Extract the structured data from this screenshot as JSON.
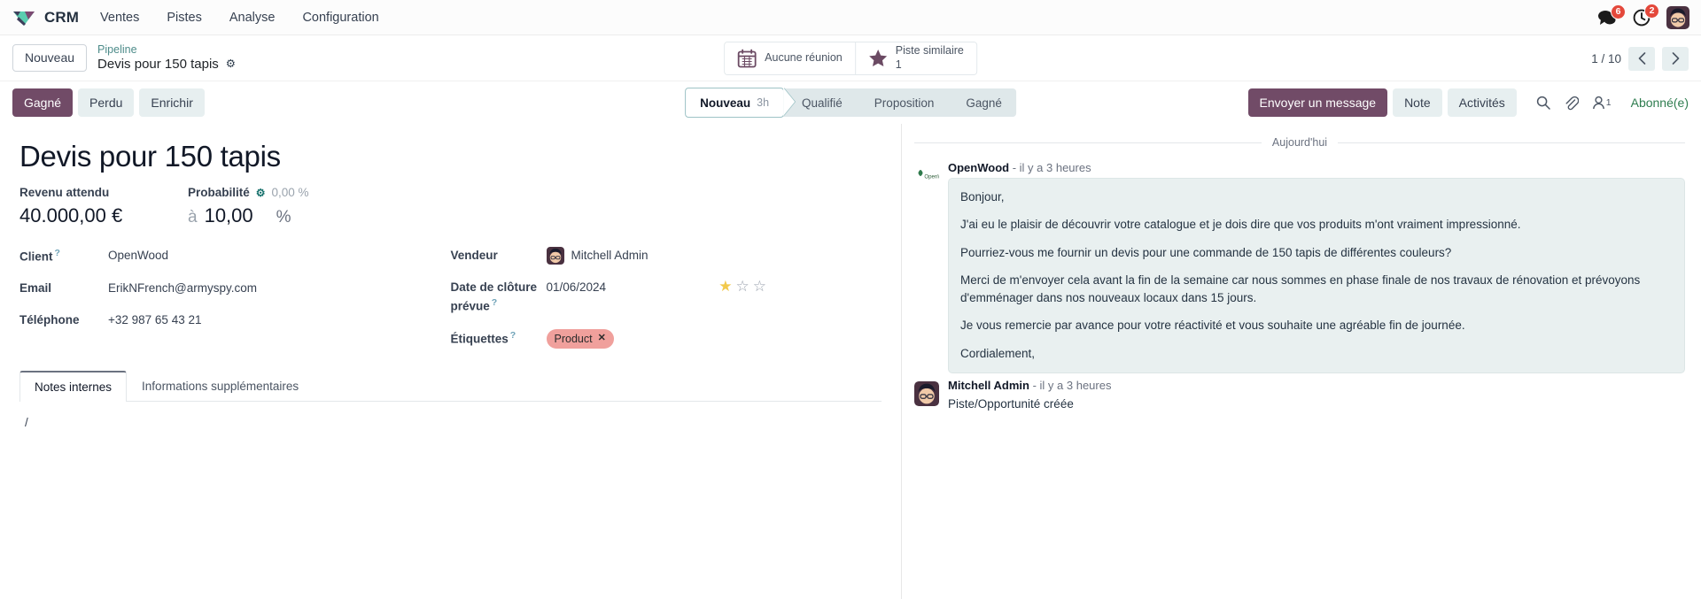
{
  "navbar": {
    "brand": "CRM",
    "links": [
      {
        "label": "Ventes"
      },
      {
        "label": "Pistes"
      },
      {
        "label": "Analyse"
      },
      {
        "label": "Configuration"
      }
    ],
    "messages_badge": "6",
    "activities_badge": "2"
  },
  "control_panel": {
    "new_button": "Nouveau",
    "breadcrumb_parent": "Pipeline",
    "breadcrumb_current": "Devis pour 150 tapis",
    "stat_meeting_label": "Aucune réunion",
    "stat_similar_label": "Piste similaire",
    "stat_similar_value": "1",
    "pager_count": "1 / 10"
  },
  "action_bar": {
    "won_button": "Gagné",
    "lost_button": "Perdu",
    "enrich_button": "Enrichir",
    "stages": [
      {
        "label": "Nouveau",
        "duration": "3h",
        "active": true
      },
      {
        "label": "Qualifié",
        "duration": "",
        "active": false
      },
      {
        "label": "Proposition",
        "duration": "",
        "active": false
      },
      {
        "label": "Gagné",
        "duration": "",
        "active": false
      }
    ],
    "send_message_button": "Envoyer un message",
    "note_button": "Note",
    "activities_button": "Activités",
    "followers_count": "1",
    "followed_label": "Abonné(e)"
  },
  "record": {
    "title": "Devis pour 150 tapis",
    "expected_revenue_label": "Revenu attendu",
    "expected_revenue_value": "40.000,00 €",
    "probability_label": "Probabilité",
    "probability_computed": "0,00 %",
    "probability_prefix": "à",
    "probability_value": "10,00",
    "probability_suffix": "%",
    "customer_label": "Client",
    "customer_value": "OpenWood",
    "email_label": "Email",
    "email_value": "ErikNFrench@armyspy.com",
    "phone_label": "Téléphone",
    "phone_value": "+32 987 65 43 21",
    "salesperson_label": "Vendeur",
    "salesperson_value": "Mitchell Admin",
    "close_date_label": "Date de clôture prévue",
    "close_date_value": "01/06/2024",
    "priority_filled": 1,
    "priority_total": 3,
    "tags_label": "Étiquettes",
    "tag_value": "Product",
    "tag_color": "#F0A09C",
    "tabs": [
      {
        "label": "Notes internes",
        "active": true
      },
      {
        "label": "Informations supplémentaires",
        "active": false
      }
    ],
    "notes_content": "/"
  },
  "chatter": {
    "day_separator": "Aujourd'hui",
    "messages": [
      {
        "author": "OpenWood",
        "time": "- il y a 3 heures",
        "type": "bubble",
        "paragraphs": [
          "Bonjour,",
          "J'ai eu le plaisir de découvrir votre catalogue et je dois dire que vos produits m'ont vraiment impressionné.",
          "Pourriez-vous me fournir un devis pour une commande de 150 tapis de différentes couleurs?",
          "Merci de m'envoyer cela avant la fin de la semaine car nous sommes en phase finale de nos travaux de rénovation et prévoyons d'emménager dans nos nouveaux locaux dans 15 jours.",
          "Je vous remercie par avance pour votre réactivité et vous souhaite une agréable fin de journée.",
          "Cordialement,"
        ]
      },
      {
        "author": "Mitchell Admin",
        "time": "- il y a 3 heures",
        "type": "plain",
        "text": "Piste/Opportunité créée"
      }
    ]
  },
  "colors": {
    "primary": "#714B67",
    "secondary": "#E7EFF0",
    "badge_red": "#E4483B",
    "followed_green": "#2E7D4F",
    "link_teal": "#4E8C8A"
  }
}
